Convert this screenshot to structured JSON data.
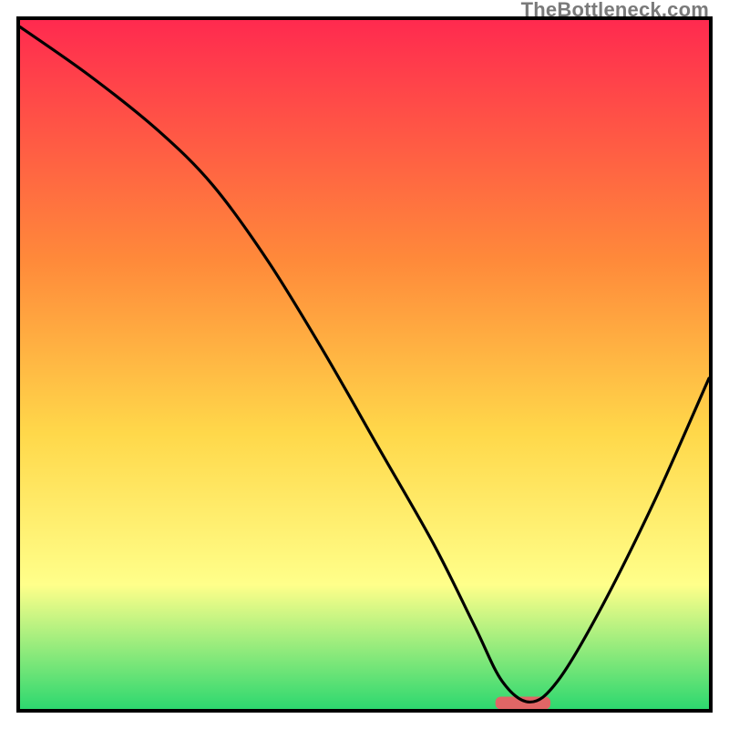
{
  "watermark": "TheBottleneck.com",
  "colors": {
    "grad_top": "#ff2a4f",
    "grad_mid1": "#ff8a3a",
    "grad_mid2": "#ffd84a",
    "grad_mid3": "#ffff8a",
    "grad_bottom": "#2dd86f",
    "curve": "#000000",
    "border": "#000000",
    "minbar": "#e06666"
  },
  "chart_data": {
    "type": "line",
    "title": "",
    "xlabel": "",
    "ylabel": "",
    "xlim": [
      0,
      100
    ],
    "ylim": [
      0,
      100
    ],
    "x": [
      0,
      10,
      20,
      28,
      36,
      44,
      52,
      60,
      66,
      70,
      74,
      78,
      84,
      92,
      100
    ],
    "values": [
      99,
      92,
      84,
      76,
      65,
      52,
      38,
      24,
      12,
      4,
      1,
      4,
      14,
      30,
      48
    ],
    "min_marker": {
      "x_start": 69,
      "x_end": 77,
      "y": 1
    },
    "grid": false,
    "legend": false
  }
}
